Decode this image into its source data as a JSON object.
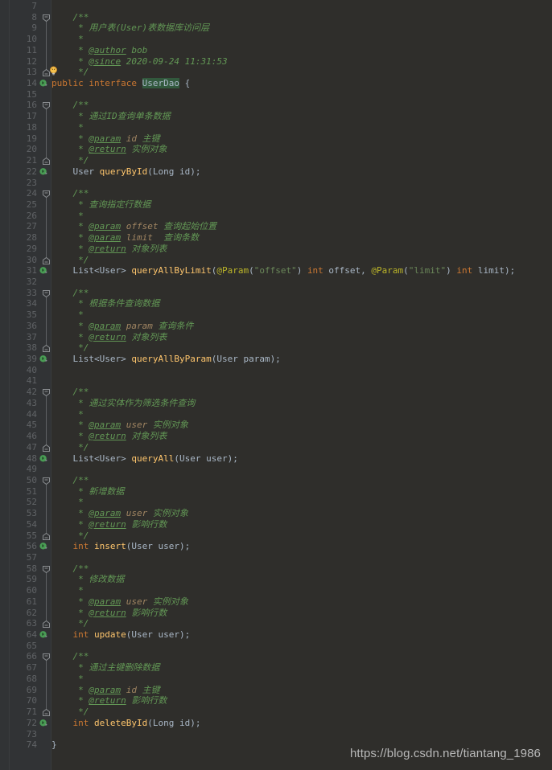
{
  "editor": {
    "file_title": "UserDao.java",
    "language": "java",
    "theme": "darcula",
    "first_visible_line": 7,
    "last_visible_line": 74,
    "colors": {
      "editor_background": "#2f2e2b",
      "gutter_background": "#313335",
      "line_number": "#606366",
      "comment_green": "#629755",
      "keyword_orange": "#cc7832",
      "method_gold": "#ffc66d",
      "type_bluegray": "#a9b7c6",
      "string_green": "#6a8759",
      "annotation_olive": "#bbb529",
      "javadoc_param_tan": "#a08562",
      "selection_green": "#32593d",
      "run_marker_green": "#499c54"
    }
  },
  "watermark": {
    "text": "https://blog.csdn.net/tiantang_1986"
  },
  "gutter": {
    "run_marker_lines": [
      14,
      22,
      31,
      39,
      48,
      56,
      64,
      72
    ],
    "bulb_lines": [
      13
    ],
    "fold_open_lines": [
      8,
      16,
      24,
      33,
      42,
      50,
      58,
      66
    ],
    "fold_close_lines": [
      13,
      21,
      30,
      38,
      47,
      55,
      63,
      71
    ],
    "icons": {
      "run_marker": "interface-implementation-icon",
      "bulb": "intention-bulb-icon",
      "fold_open": "fold-collapse-icon",
      "fold_close": "fold-end-icon"
    }
  },
  "code": {
    "lines": [
      {
        "n": 7,
        "tokens": []
      },
      {
        "n": 8,
        "tokens": [
          {
            "t": "    ",
            "c": "punct"
          },
          {
            "t": "/**",
            "c": "cmt"
          }
        ]
      },
      {
        "n": 9,
        "tokens": [
          {
            "t": "     * ",
            "c": "cmt"
          },
          {
            "t": "用户表",
            "c": "cmt-cn"
          },
          {
            "t": "(User)",
            "c": "cmt"
          },
          {
            "t": "表数据库访问层",
            "c": "cmt-cn"
          }
        ]
      },
      {
        "n": 10,
        "tokens": [
          {
            "t": "     *",
            "c": "cmt"
          }
        ]
      },
      {
        "n": 11,
        "tokens": [
          {
            "t": "     * ",
            "c": "cmt"
          },
          {
            "t": "@author",
            "c": "cmt-tag"
          },
          {
            "t": " bob",
            "c": "cmt"
          }
        ]
      },
      {
        "n": 12,
        "tokens": [
          {
            "t": "     * ",
            "c": "cmt"
          },
          {
            "t": "@since",
            "c": "cmt-tag"
          },
          {
            "t": " 2020-09-24 11:31:53",
            "c": "cmt"
          }
        ]
      },
      {
        "n": 13,
        "tokens": [
          {
            "t": "     */",
            "c": "cmt"
          }
        ]
      },
      {
        "n": 14,
        "tokens": [
          {
            "t": "public",
            "c": "kw"
          },
          {
            "t": " ",
            "c": "punct"
          },
          {
            "t": "interface",
            "c": "kw"
          },
          {
            "t": " ",
            "c": "punct"
          },
          {
            "t": "UserDao",
            "c": "type sel"
          },
          {
            "t": " {",
            "c": "punct"
          }
        ]
      },
      {
        "n": 15,
        "tokens": []
      },
      {
        "n": 16,
        "tokens": [
          {
            "t": "    /**",
            "c": "cmt"
          }
        ]
      },
      {
        "n": 17,
        "tokens": [
          {
            "t": "     * ",
            "c": "cmt"
          },
          {
            "t": "通过",
            "c": "cmt-cn"
          },
          {
            "t": "ID",
            "c": "cmt"
          },
          {
            "t": "查询单条数据",
            "c": "cmt-cn"
          }
        ]
      },
      {
        "n": 18,
        "tokens": [
          {
            "t": "     *",
            "c": "cmt"
          }
        ]
      },
      {
        "n": 19,
        "tokens": [
          {
            "t": "     * ",
            "c": "cmt"
          },
          {
            "t": "@param",
            "c": "cmt-tag"
          },
          {
            "t": " id ",
            "c": "cmt-param"
          },
          {
            "t": "主键",
            "c": "cmt-cn"
          }
        ]
      },
      {
        "n": 20,
        "tokens": [
          {
            "t": "     * ",
            "c": "cmt"
          },
          {
            "t": "@return",
            "c": "cmt-tag"
          },
          {
            "t": " ",
            "c": "cmt"
          },
          {
            "t": "实例对象",
            "c": "cmt-cn"
          }
        ]
      },
      {
        "n": 21,
        "tokens": [
          {
            "t": "     */",
            "c": "cmt"
          }
        ]
      },
      {
        "n": 22,
        "tokens": [
          {
            "t": "    ",
            "c": "punct"
          },
          {
            "t": "User",
            "c": "type"
          },
          {
            "t": " ",
            "c": "punct"
          },
          {
            "t": "queryById",
            "c": "method"
          },
          {
            "t": "(",
            "c": "punct"
          },
          {
            "t": "Long",
            "c": "type"
          },
          {
            "t": " id);",
            "c": "punct"
          }
        ]
      },
      {
        "n": 23,
        "tokens": []
      },
      {
        "n": 24,
        "tokens": [
          {
            "t": "    /**",
            "c": "cmt"
          }
        ]
      },
      {
        "n": 25,
        "tokens": [
          {
            "t": "     * ",
            "c": "cmt"
          },
          {
            "t": "查询指定行数据",
            "c": "cmt-cn"
          }
        ]
      },
      {
        "n": 26,
        "tokens": [
          {
            "t": "     *",
            "c": "cmt"
          }
        ]
      },
      {
        "n": 27,
        "tokens": [
          {
            "t": "     * ",
            "c": "cmt"
          },
          {
            "t": "@param",
            "c": "cmt-tag"
          },
          {
            "t": " offset ",
            "c": "cmt-param"
          },
          {
            "t": "查询起始位置",
            "c": "cmt-cn"
          }
        ]
      },
      {
        "n": 28,
        "tokens": [
          {
            "t": "     * ",
            "c": "cmt"
          },
          {
            "t": "@param",
            "c": "cmt-tag"
          },
          {
            "t": " limit  ",
            "c": "cmt-param"
          },
          {
            "t": "查询条数",
            "c": "cmt-cn"
          }
        ]
      },
      {
        "n": 29,
        "tokens": [
          {
            "t": "     * ",
            "c": "cmt"
          },
          {
            "t": "@return",
            "c": "cmt-tag"
          },
          {
            "t": " ",
            "c": "cmt"
          },
          {
            "t": "对象列表",
            "c": "cmt-cn"
          }
        ]
      },
      {
        "n": 30,
        "tokens": [
          {
            "t": "     */",
            "c": "cmt"
          }
        ]
      },
      {
        "n": 31,
        "tokens": [
          {
            "t": "    ",
            "c": "punct"
          },
          {
            "t": "List<User>",
            "c": "type"
          },
          {
            "t": " ",
            "c": "punct"
          },
          {
            "t": "queryAllByLimit",
            "c": "method"
          },
          {
            "t": "(",
            "c": "punct"
          },
          {
            "t": "@Param",
            "c": "anno"
          },
          {
            "t": "(",
            "c": "punct"
          },
          {
            "t": "\"offset\"",
            "c": "str"
          },
          {
            "t": ") ",
            "c": "punct"
          },
          {
            "t": "int",
            "c": "kw"
          },
          {
            "t": " offset, ",
            "c": "punct"
          },
          {
            "t": "@Param",
            "c": "anno"
          },
          {
            "t": "(",
            "c": "punct"
          },
          {
            "t": "\"limit\"",
            "c": "str"
          },
          {
            "t": ") ",
            "c": "punct"
          },
          {
            "t": "int",
            "c": "kw"
          },
          {
            "t": " limit);",
            "c": "punct"
          }
        ]
      },
      {
        "n": 32,
        "tokens": []
      },
      {
        "n": 33,
        "tokens": [
          {
            "t": "    /**",
            "c": "cmt"
          }
        ]
      },
      {
        "n": 34,
        "tokens": [
          {
            "t": "     * ",
            "c": "cmt"
          },
          {
            "t": "根据条件查询数据",
            "c": "cmt-cn"
          }
        ]
      },
      {
        "n": 35,
        "tokens": [
          {
            "t": "     *",
            "c": "cmt"
          }
        ]
      },
      {
        "n": 36,
        "tokens": [
          {
            "t": "     * ",
            "c": "cmt"
          },
          {
            "t": "@param",
            "c": "cmt-tag"
          },
          {
            "t": " param ",
            "c": "cmt-param"
          },
          {
            "t": "查询条件",
            "c": "cmt-cn"
          }
        ]
      },
      {
        "n": 37,
        "tokens": [
          {
            "t": "     * ",
            "c": "cmt"
          },
          {
            "t": "@return",
            "c": "cmt-tag"
          },
          {
            "t": " ",
            "c": "cmt"
          },
          {
            "t": "对象列表",
            "c": "cmt-cn"
          }
        ]
      },
      {
        "n": 38,
        "tokens": [
          {
            "t": "     */",
            "c": "cmt"
          }
        ]
      },
      {
        "n": 39,
        "tokens": [
          {
            "t": "    ",
            "c": "punct"
          },
          {
            "t": "List<User>",
            "c": "type"
          },
          {
            "t": " ",
            "c": "punct"
          },
          {
            "t": "queryAllByParam",
            "c": "method"
          },
          {
            "t": "(",
            "c": "punct"
          },
          {
            "t": "User",
            "c": "type"
          },
          {
            "t": " param);",
            "c": "punct"
          }
        ]
      },
      {
        "n": 40,
        "tokens": []
      },
      {
        "n": 41,
        "tokens": []
      },
      {
        "n": 42,
        "tokens": [
          {
            "t": "    /**",
            "c": "cmt"
          }
        ]
      },
      {
        "n": 43,
        "tokens": [
          {
            "t": "     * ",
            "c": "cmt"
          },
          {
            "t": "通过实体作为筛选条件查询",
            "c": "cmt-cn"
          }
        ]
      },
      {
        "n": 44,
        "tokens": [
          {
            "t": "     *",
            "c": "cmt"
          }
        ]
      },
      {
        "n": 45,
        "tokens": [
          {
            "t": "     * ",
            "c": "cmt"
          },
          {
            "t": "@param",
            "c": "cmt-tag"
          },
          {
            "t": " user ",
            "c": "cmt-param"
          },
          {
            "t": "实例对象",
            "c": "cmt-cn"
          }
        ]
      },
      {
        "n": 46,
        "tokens": [
          {
            "t": "     * ",
            "c": "cmt"
          },
          {
            "t": "@return",
            "c": "cmt-tag"
          },
          {
            "t": " ",
            "c": "cmt"
          },
          {
            "t": "对象列表",
            "c": "cmt-cn"
          }
        ]
      },
      {
        "n": 47,
        "tokens": [
          {
            "t": "     */",
            "c": "cmt"
          }
        ]
      },
      {
        "n": 48,
        "tokens": [
          {
            "t": "    ",
            "c": "punct"
          },
          {
            "t": "List<User>",
            "c": "type"
          },
          {
            "t": " ",
            "c": "punct"
          },
          {
            "t": "queryAll",
            "c": "method"
          },
          {
            "t": "(",
            "c": "punct"
          },
          {
            "t": "User",
            "c": "type"
          },
          {
            "t": " user);",
            "c": "punct"
          }
        ]
      },
      {
        "n": 49,
        "tokens": []
      },
      {
        "n": 50,
        "tokens": [
          {
            "t": "    /**",
            "c": "cmt"
          }
        ]
      },
      {
        "n": 51,
        "tokens": [
          {
            "t": "     * ",
            "c": "cmt"
          },
          {
            "t": "新增数据",
            "c": "cmt-cn"
          }
        ]
      },
      {
        "n": 52,
        "tokens": [
          {
            "t": "     *",
            "c": "cmt"
          }
        ]
      },
      {
        "n": 53,
        "tokens": [
          {
            "t": "     * ",
            "c": "cmt"
          },
          {
            "t": "@param",
            "c": "cmt-tag"
          },
          {
            "t": " user ",
            "c": "cmt-param"
          },
          {
            "t": "实例对象",
            "c": "cmt-cn"
          }
        ]
      },
      {
        "n": 54,
        "tokens": [
          {
            "t": "     * ",
            "c": "cmt"
          },
          {
            "t": "@return",
            "c": "cmt-tag"
          },
          {
            "t": " ",
            "c": "cmt"
          },
          {
            "t": "影响行数",
            "c": "cmt-cn"
          }
        ]
      },
      {
        "n": 55,
        "tokens": [
          {
            "t": "     */",
            "c": "cmt"
          }
        ]
      },
      {
        "n": 56,
        "tokens": [
          {
            "t": "    ",
            "c": "punct"
          },
          {
            "t": "int",
            "c": "kw"
          },
          {
            "t": " ",
            "c": "punct"
          },
          {
            "t": "insert",
            "c": "method"
          },
          {
            "t": "(",
            "c": "punct"
          },
          {
            "t": "User",
            "c": "type"
          },
          {
            "t": " user);",
            "c": "punct"
          }
        ]
      },
      {
        "n": 57,
        "tokens": []
      },
      {
        "n": 58,
        "tokens": [
          {
            "t": "    /**",
            "c": "cmt"
          }
        ]
      },
      {
        "n": 59,
        "tokens": [
          {
            "t": "     * ",
            "c": "cmt"
          },
          {
            "t": "修改数据",
            "c": "cmt-cn"
          }
        ]
      },
      {
        "n": 60,
        "tokens": [
          {
            "t": "     *",
            "c": "cmt"
          }
        ]
      },
      {
        "n": 61,
        "tokens": [
          {
            "t": "     * ",
            "c": "cmt"
          },
          {
            "t": "@param",
            "c": "cmt-tag"
          },
          {
            "t": " user ",
            "c": "cmt-param"
          },
          {
            "t": "实例对象",
            "c": "cmt-cn"
          }
        ]
      },
      {
        "n": 62,
        "tokens": [
          {
            "t": "     * ",
            "c": "cmt"
          },
          {
            "t": "@return",
            "c": "cmt-tag"
          },
          {
            "t": " ",
            "c": "cmt"
          },
          {
            "t": "影响行数",
            "c": "cmt-cn"
          }
        ]
      },
      {
        "n": 63,
        "tokens": [
          {
            "t": "     */",
            "c": "cmt"
          }
        ]
      },
      {
        "n": 64,
        "tokens": [
          {
            "t": "    ",
            "c": "punct"
          },
          {
            "t": "int",
            "c": "kw"
          },
          {
            "t": " ",
            "c": "punct"
          },
          {
            "t": "update",
            "c": "method"
          },
          {
            "t": "(",
            "c": "punct"
          },
          {
            "t": "User",
            "c": "type"
          },
          {
            "t": " user);",
            "c": "punct"
          }
        ]
      },
      {
        "n": 65,
        "tokens": []
      },
      {
        "n": 66,
        "tokens": [
          {
            "t": "    /**",
            "c": "cmt"
          }
        ]
      },
      {
        "n": 67,
        "tokens": [
          {
            "t": "     * ",
            "c": "cmt"
          },
          {
            "t": "通过主键删除数据",
            "c": "cmt-cn"
          }
        ]
      },
      {
        "n": 68,
        "tokens": [
          {
            "t": "     *",
            "c": "cmt"
          }
        ]
      },
      {
        "n": 69,
        "tokens": [
          {
            "t": "     * ",
            "c": "cmt"
          },
          {
            "t": "@param",
            "c": "cmt-tag"
          },
          {
            "t": " id ",
            "c": "cmt-param"
          },
          {
            "t": "主键",
            "c": "cmt-cn"
          }
        ]
      },
      {
        "n": 70,
        "tokens": [
          {
            "t": "     * ",
            "c": "cmt"
          },
          {
            "t": "@return",
            "c": "cmt-tag"
          },
          {
            "t": " ",
            "c": "cmt"
          },
          {
            "t": "影响行数",
            "c": "cmt-cn"
          }
        ]
      },
      {
        "n": 71,
        "tokens": [
          {
            "t": "     */",
            "c": "cmt"
          }
        ]
      },
      {
        "n": 72,
        "tokens": [
          {
            "t": "    ",
            "c": "punct"
          },
          {
            "t": "int",
            "c": "kw"
          },
          {
            "t": " ",
            "c": "punct"
          },
          {
            "t": "deleteById",
            "c": "method"
          },
          {
            "t": "(",
            "c": "punct"
          },
          {
            "t": "Long",
            "c": "type"
          },
          {
            "t": " id);",
            "c": "punct"
          }
        ]
      },
      {
        "n": 73,
        "tokens": []
      },
      {
        "n": 74,
        "tokens": [
          {
            "t": "}",
            "c": "punct"
          }
        ]
      }
    ]
  }
}
